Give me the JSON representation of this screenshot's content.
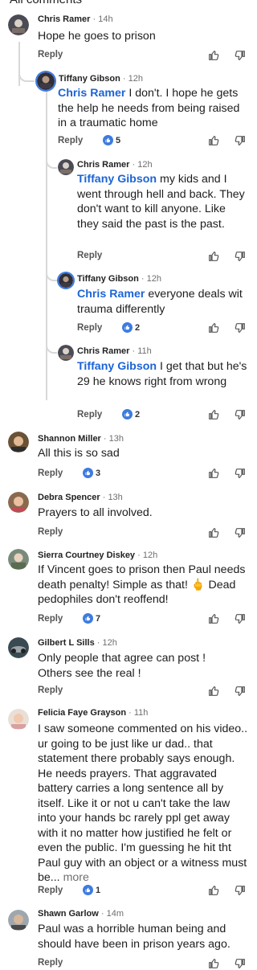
{
  "header": {
    "title": "All comments"
  },
  "labels": {
    "reply": "Reply",
    "more": "more"
  },
  "comments": [
    {
      "name": "Chris Ramer",
      "time": "· 14h",
      "text": "Hope he goes to prison"
    },
    {
      "name": "Tiffany Gibson",
      "time": "· 12h",
      "mention": "Chris Ramer",
      "text": " I don't.  I hope he gets the help he needs from being raised in a traumatic home",
      "likes": "5"
    },
    {
      "name": "Chris Ramer",
      "time": "· 12h",
      "mention": "Tiffany Gibson",
      "text": " my kids and I went through hell and back. They don't want to kill anyone. Like they said the past is the past."
    },
    {
      "name": "Tiffany Gibson",
      "time": "· 12h",
      "mention": "Chris Ramer",
      "text": " everyone deals wit trauma differently",
      "likes": "2"
    },
    {
      "name": "Chris Ramer",
      "time": "· 11h",
      "mention": "Tiffany Gibson",
      "text": " I get that but he's 29 he knows right from wrong",
      "likes": "2"
    },
    {
      "name": "Shannon Miller",
      "time": "· 13h",
      "text": "All this is so sad",
      "likes": "3"
    },
    {
      "name": "Debra Spencer",
      "time": "· 13h",
      "text": "Prayers to all involved."
    },
    {
      "name": "Sierra Courtney Diskey",
      "time": "· 12h",
      "text": "If Vincent goes to prison then Paul needs death penalty! Simple as that! 🖕 Dead pedophiles don't reoffend!",
      "likes": "7"
    },
    {
      "name": "Gilbert L Sills",
      "time": "· 12h",
      "text": "Only people that agree can post ! Others see the real !"
    },
    {
      "name": "Felicia Faye Grayson",
      "time": "· 11h",
      "text": "I saw someone commented on his video.. ur going to be just like ur dad.. that statement there probably says enough. He needs prayers. That aggravated battery carries a long sentence all by itself. Like it or not u can't take the law into your hands bc rarely ppl get away with it no matter how justified he felt or even the public. I'm guessing he hit tht Paul guy with an object or a witness must be...",
      "likes": "1"
    },
    {
      "name": "Shawn Garlow",
      "time": "· 14m",
      "text": "Paul was a horrible human being and should have been in prison years ago."
    }
  ],
  "colors": {
    "mention": "#1c64d6",
    "like": "#3d7be0",
    "thread_line": "#d8d8d8"
  },
  "icons": [
    "thumbs-up-icon",
    "thumbs-down-icon",
    "like-badge-icon"
  ]
}
